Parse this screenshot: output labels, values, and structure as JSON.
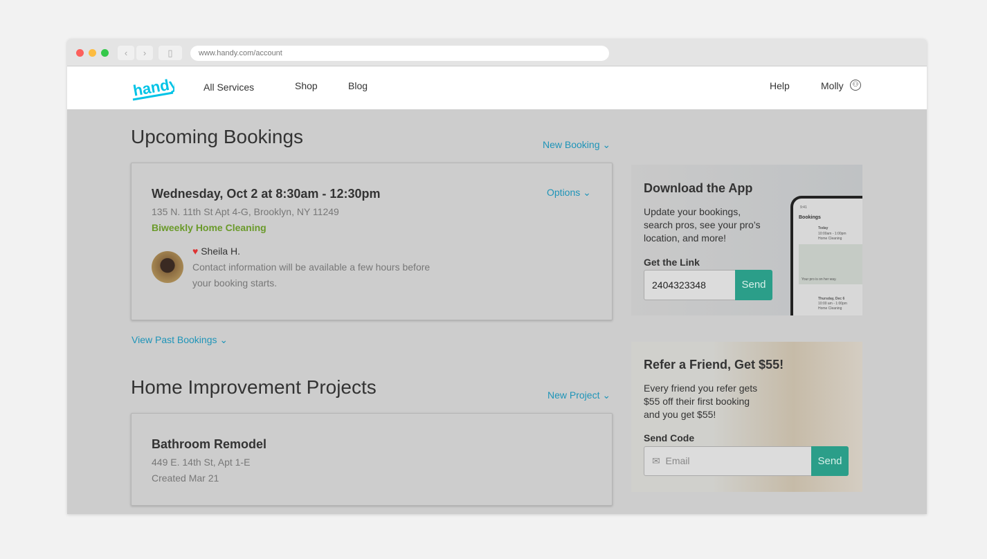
{
  "browser": {
    "url": "www.handy.com/account"
  },
  "nav": {
    "logo": "handy",
    "links": [
      "All Services",
      "Shop",
      "Blog"
    ],
    "help": "Help",
    "user": "Molly"
  },
  "upcoming": {
    "title": "Upcoming Bookings",
    "new_link": "New Booking",
    "booking": {
      "datetime": "Wednesday, Oct 2 at 8:30am - 12:30pm",
      "address": "135 N. 11th St Apt 4-G, Brooklyn, NY 11249",
      "service": "Biweekly Home Cleaning",
      "options": "Options",
      "pro": "Sheila H.",
      "contact_note_1": "Contact information will be available a few hours before",
      "contact_note_2": "your booking starts."
    },
    "past_link": "View Past Bookings"
  },
  "projects": {
    "title": "Home Improvement Projects",
    "new_link": "New Project",
    "project": {
      "name": "Bathroom Remodel",
      "address": "449 E. 14th St, Apt 1-E",
      "created": "Created Mar 21"
    }
  },
  "app_promo": {
    "title": "Download the App",
    "text": [
      "Update your bookings,",
      "search pros, see your pro’s",
      "location, and more!"
    ],
    "link_label": "Get the Link",
    "phone_value": "2404323348",
    "send": "Send",
    "phone": {
      "time": "9:41",
      "title": "Bookings",
      "item1": "Today",
      "item1_time": "10:00am - 1:00pm",
      "item1_service": "Home Cleaning",
      "status": "Your pro is on her way.",
      "item2": "Thursday, Dec 6",
      "item2_time": "10:00 am - 1:00pm",
      "item2_service": "Home Cleaning"
    }
  },
  "refer": {
    "title": "Refer a Friend, Get $55!",
    "text": [
      "Every friend you refer gets",
      "$55 off their first booking",
      "and you get $55!"
    ],
    "code_label": "Send Code",
    "email_placeholder": "Email",
    "send": "Send"
  }
}
